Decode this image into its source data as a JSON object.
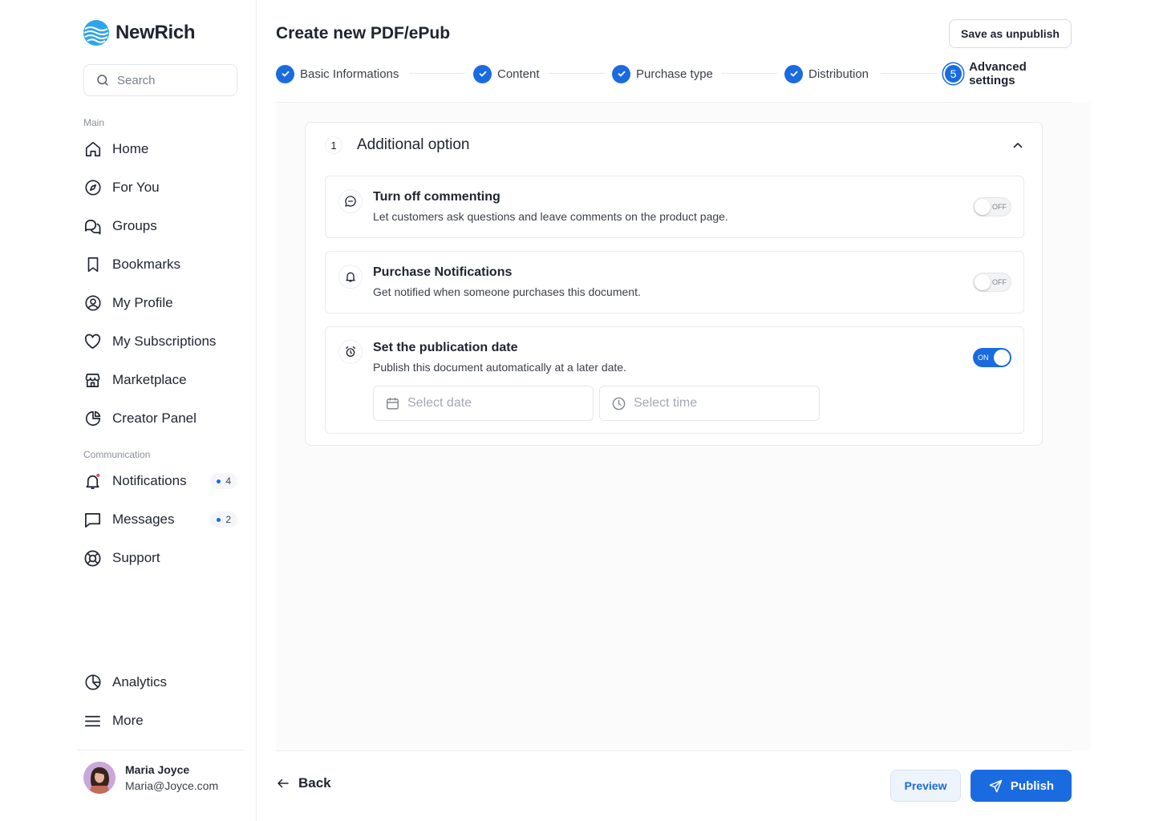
{
  "brand": {
    "name": "NewRich"
  },
  "search": {
    "placeholder": "Search"
  },
  "sidebar": {
    "main_label": "Main",
    "main_items": [
      {
        "label": "Home",
        "icon": "home-icon"
      },
      {
        "label": "For You",
        "icon": "compass-icon"
      },
      {
        "label": "Groups",
        "icon": "chat-bubbles-icon"
      },
      {
        "label": "Bookmarks",
        "icon": "bookmark-icon"
      },
      {
        "label": "My Profile",
        "icon": "user-circle-icon"
      },
      {
        "label": "My Subscriptions",
        "icon": "heart-icon"
      },
      {
        "label": "Marketplace",
        "icon": "store-icon"
      },
      {
        "label": "Creator Panel",
        "icon": "pie-chart-icon"
      }
    ],
    "communication_label": "Communication",
    "communication_items": [
      {
        "label": "Notifications",
        "icon": "bell-icon",
        "badge": "4"
      },
      {
        "label": "Messages",
        "icon": "message-icon",
        "badge": "2"
      },
      {
        "label": "Support",
        "icon": "lifebuoy-icon"
      }
    ],
    "bottom_items": [
      {
        "label": "Analytics",
        "icon": "analytics-icon"
      },
      {
        "label": "More",
        "icon": "menu-icon"
      }
    ]
  },
  "user": {
    "name": "Maria Joyce",
    "email": "Maria@Joyce.com"
  },
  "header": {
    "title": "Create new PDF/ePub",
    "save_label": "Save as unpublish"
  },
  "steps": [
    {
      "label": "Basic Informations",
      "state": "done"
    },
    {
      "label": "Content",
      "state": "done"
    },
    {
      "label": "Purchase type",
      "state": "done"
    },
    {
      "label": "Distribution",
      "state": "done"
    },
    {
      "label": "Advanced settings",
      "state": "active",
      "number": "5"
    }
  ],
  "section": {
    "number": "1",
    "title": "Additional option",
    "options": [
      {
        "title": "Turn off commenting",
        "description": "Let customers ask questions and leave comments on the product page.",
        "toggle": "OFF",
        "icon": "comment-icon"
      },
      {
        "title": "Purchase Notifications",
        "description": "Get notified when someone purchases this document.",
        "toggle": "OFF",
        "icon": "bell-icon"
      },
      {
        "title": "Set the publication date",
        "description": "Publish this document automatically at a later date.",
        "toggle": "ON",
        "icon": "alarm-clock-icon"
      }
    ],
    "date_placeholder": "Select date",
    "time_placeholder": "Select time"
  },
  "footer": {
    "back_label": "Back",
    "preview_label": "Preview",
    "publish_label": "Publish"
  },
  "colors": {
    "accent": "#1a6be0",
    "text": "#1f2430",
    "muted": "#8b909a",
    "notification_dot": "#e5484d"
  }
}
